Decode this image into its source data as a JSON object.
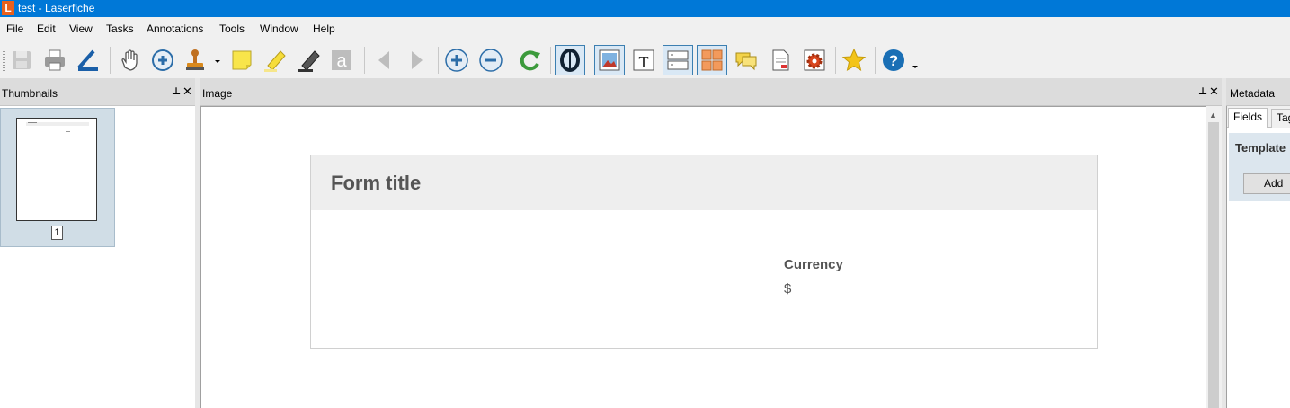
{
  "window": {
    "title": "test - Laserfiche",
    "app_icon_letter": "L"
  },
  "menu": [
    "File",
    "Edit",
    "View",
    "Tasks",
    "Annotations",
    "Tools",
    "Window",
    "Help"
  ],
  "toolbar": {
    "icons": [
      "save-icon",
      "print-icon",
      "scanner-icon",
      "hand-icon",
      "zoom-in-icon",
      "stamp-icon",
      "sticky-note-icon",
      "highlighter-icon",
      "marker-icon",
      "text-annotation-icon",
      "previous-icon",
      "next-icon",
      "add-icon",
      "remove-icon",
      "rotate-icon",
      "ocr-icon",
      "image-view-icon",
      "text-view-icon",
      "split-view-icon",
      "thumbnail-grid-icon",
      "comments-icon",
      "document-icon",
      "settings-gear-icon",
      "favorite-star-icon",
      "help-icon"
    ],
    "accent": "#1a6fb5"
  },
  "panels": {
    "thumbnails": {
      "title": "Thumbnails",
      "pages": [
        {
          "number": "1"
        }
      ]
    },
    "image": {
      "title": "Image"
    },
    "metadata": {
      "title": "Metadata",
      "tabs": [
        "Fields",
        "Tag"
      ],
      "template_label": "Template",
      "add_button": "Add"
    }
  },
  "form": {
    "title": "Form title",
    "fields": [
      {
        "label": "Currency",
        "value": "$"
      }
    ]
  }
}
